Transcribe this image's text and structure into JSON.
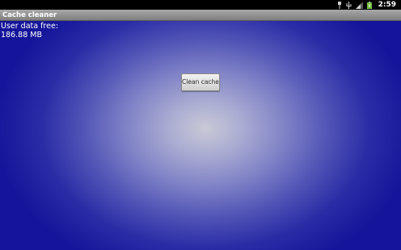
{
  "status_bar": {
    "time": "2:59",
    "icons": [
      "usb-debug-icon",
      "usb-icon",
      "wifi-icon",
      "battery-icon"
    ]
  },
  "app": {
    "title": "Cache cleaner"
  },
  "storage": {
    "label": "User data free:",
    "value": "186.88 MB"
  },
  "actions": {
    "clean_label": "Clean cache"
  },
  "colors": {
    "background_edge": "#14159a",
    "background_center": "#c9c9d6",
    "title_bar": "#9a9a9a",
    "battery_accent": "#76c043"
  }
}
